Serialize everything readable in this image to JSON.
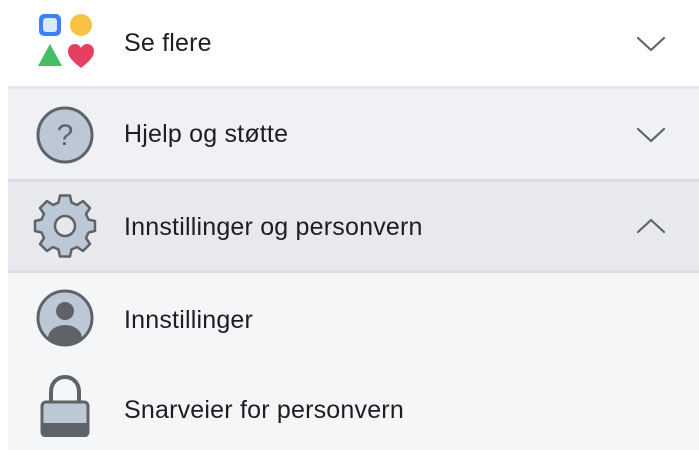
{
  "menu": {
    "items": [
      {
        "label": "Se flere",
        "icon": "shapes-icon",
        "chevron": "chevron-down-icon",
        "expanded": false
      },
      {
        "label": "Hjelp og støtte",
        "icon": "help-icon",
        "chevron": "chevron-down-icon",
        "expanded": false
      },
      {
        "label": "Innstillinger og personvern",
        "icon": "settings-gear-icon",
        "chevron": "chevron-up-icon",
        "expanded": true
      }
    ],
    "subitems": [
      {
        "label": "Innstillinger",
        "icon": "profile-icon"
      },
      {
        "label": "Snarveier for personvern",
        "icon": "lock-icon"
      }
    ]
  },
  "colors": {
    "icon_gray": "#5f6368",
    "icon_fill": "#bcc8d6",
    "shape_blue": "#3b82f6",
    "shape_yellow": "#f6c343",
    "shape_green": "#45bd62",
    "shape_red": "#e4405f"
  }
}
